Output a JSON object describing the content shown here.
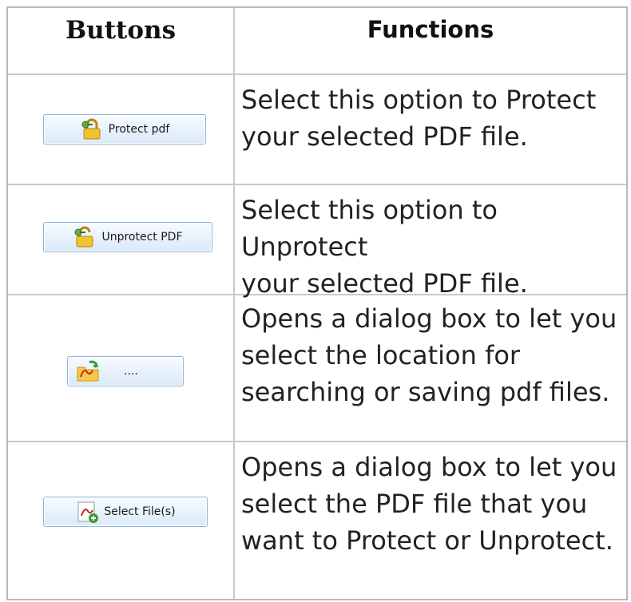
{
  "table": {
    "headers": {
      "buttons": "Buttons",
      "functions": "Functions"
    },
    "rows": [
      {
        "button_label": "Protect pdf",
        "button_icon": "lock-key-icon",
        "description": "Select this option to Protect\nyour selected PDF file."
      },
      {
        "button_label": "Unprotect PDF",
        "button_icon": "unlock-key-icon",
        "description": "Select this option to Unprotect\nyour selected PDF file."
      },
      {
        "button_label": "....",
        "button_icon": "pdf-folder-icon",
        "description": "Opens a dialog box to let you\nselect the location for\nsearching or saving pdf files."
      },
      {
        "button_label": "Select File(s)",
        "button_icon": "pdf-add-file-icon",
        "description": "Opens a dialog box to let you\nselect the PDF file that you\nwant to Protect or Unprotect."
      }
    ]
  }
}
